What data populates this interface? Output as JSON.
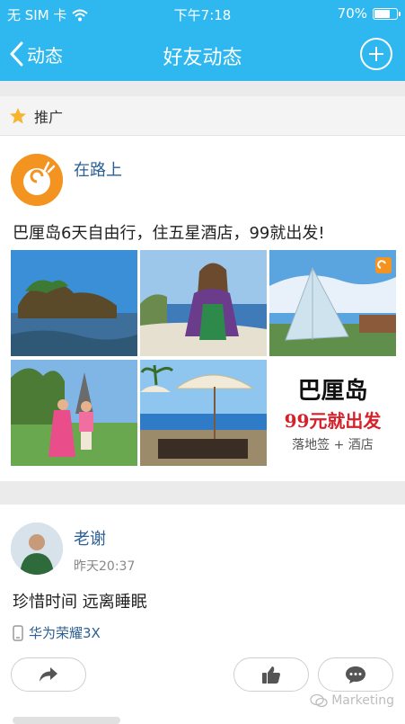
{
  "status_bar": {
    "carrier": "无 SIM 卡",
    "time": "下午7:18",
    "battery_percent": "70%",
    "battery_level": 0.7
  },
  "nav": {
    "back_label": "动态",
    "title": "好友动态"
  },
  "promo": {
    "header_label": "推广"
  },
  "post1": {
    "author": "在路上",
    "text": "巴厘岛6天自由行，住五星酒店，99就出发!",
    "ad_image": {
      "title": "巴厘岛",
      "price": "99元就出发",
      "subtitle": "落地签 + 酒店"
    }
  },
  "post2": {
    "author": "老谢",
    "time": "昨天20:37",
    "text": "珍惜时间  远离睡眠",
    "device": "华为荣耀3X"
  },
  "watermark": "Marketing",
  "colors": {
    "brand_blue": "#2fb8f0",
    "link_blue": "#2c5f93",
    "promo_star": "#f6b42f"
  }
}
